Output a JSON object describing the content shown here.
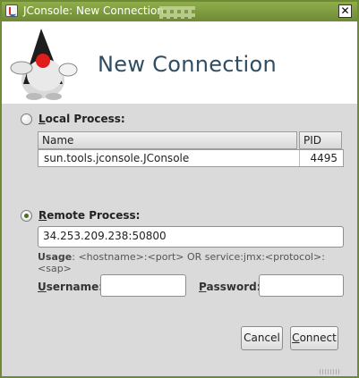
{
  "window": {
    "title": "JConsole: New Connection",
    "close_glyph": "✕"
  },
  "header": {
    "title": "New Connection",
    "logo_icon": "duke-mascot-icon"
  },
  "local_process": {
    "label_mnemonic": "L",
    "label_rest": "ocal Process:",
    "selected": false,
    "columns": [
      "Name",
      "PID"
    ],
    "rows": [
      {
        "name": "sun.tools.jconsole.JConsole",
        "pid": "4495"
      }
    ]
  },
  "remote_process": {
    "label_mnemonic": "R",
    "label_rest": "emote Process:",
    "selected": true,
    "address_value": "34.253.209.238:50800",
    "usage_label": "Usage",
    "usage_text": ": <hostname>:<port> OR service:jmx:<protocol>:<sap>",
    "username_mnemonic": "U",
    "username_rest": "sername:",
    "username_value": "",
    "password_mnemonic": "P",
    "password_rest": "assword:",
    "password_value": ""
  },
  "buttons": {
    "cancel_label": "Cancel",
    "connect_mnemonic": "C",
    "connect_rest": "onnect"
  },
  "colors": {
    "titlebar": "#7a963c",
    "header_title": "#2f4d63",
    "dialog_bg": "#dadada"
  }
}
